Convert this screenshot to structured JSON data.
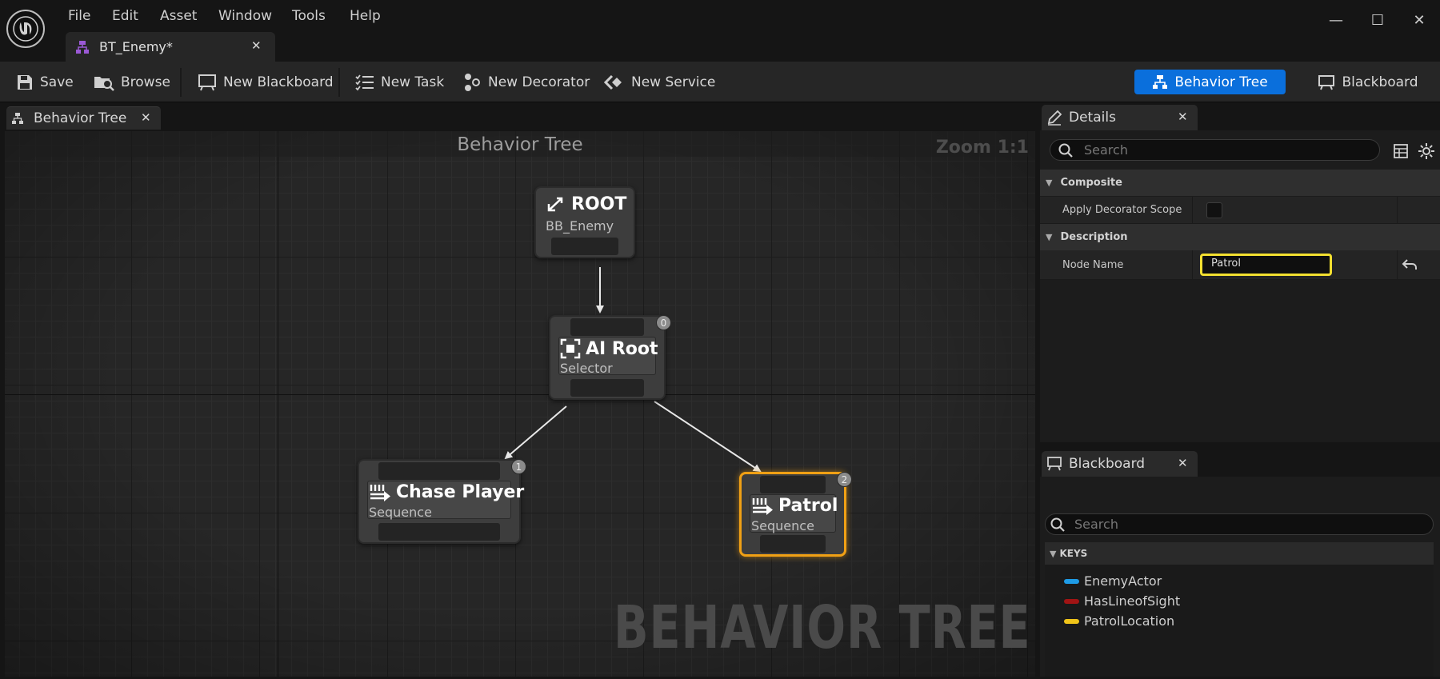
{
  "window": {
    "menus": [
      "File",
      "Edit",
      "Asset",
      "Window",
      "Tools",
      "Help"
    ],
    "document_tab": "BT_Enemy*",
    "controls": {
      "minimize": "—",
      "maximize": "☐",
      "close": "✕"
    }
  },
  "toolbar": {
    "save": "Save",
    "browse": "Browse",
    "new_blackboard": "New Blackboard",
    "new_task": "New Task",
    "new_decorator": "New Decorator",
    "new_service": "New Service",
    "mode_behavior_tree": "Behavior Tree",
    "mode_blackboard": "Blackboard"
  },
  "graph": {
    "tab": "Behavior Tree",
    "title": "Behavior Tree",
    "zoom": "Zoom 1:1",
    "watermark": "BEHAVIOR TREE",
    "nodes": {
      "root": {
        "title": "ROOT",
        "subtitle": "BB_Enemy"
      },
      "ai_root": {
        "title": "AI Root",
        "subtitle": "Selector",
        "index": "0"
      },
      "chase": {
        "title": "Chase Player",
        "subtitle": "Sequence",
        "index": "1"
      },
      "patrol": {
        "title": "Patrol",
        "subtitle": "Sequence",
        "index": "2"
      }
    }
  },
  "details": {
    "tab": "Details",
    "search_placeholder": "Search",
    "categories": {
      "composite": "Composite",
      "description": "Description"
    },
    "props": {
      "apply_decorator_scope": "Apply Decorator Scope",
      "node_name_label": "Node Name",
      "node_name_value": "Patrol"
    }
  },
  "blackboard": {
    "tab": "Blackboard",
    "search_placeholder": "Search",
    "keys_header": "KEYS",
    "keys": [
      {
        "name": "EnemyActor",
        "color": "#1e9be6"
      },
      {
        "name": "HasLineofSight",
        "color": "#a11414"
      },
      {
        "name": "PatrolLocation",
        "color": "#f0c419"
      }
    ]
  },
  "colors": {
    "accent_blue": "#0a6fdc",
    "selection_orange": "#f0a015",
    "input_focus_yellow": "#f2df30"
  }
}
